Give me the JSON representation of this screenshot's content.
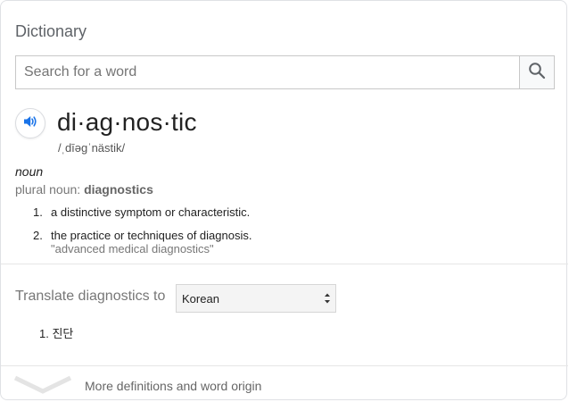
{
  "dictionary": {
    "title": "Dictionary",
    "search": {
      "placeholder": "Search for a word",
      "value": ""
    },
    "icons": {
      "search": "search-icon",
      "audio": "speaker-icon",
      "expand": "chevron-down-icon"
    },
    "entry": {
      "headword": "di·ag·nos·tic",
      "phonetic": "/ˌdīəɡˈnästik/",
      "part_of_speech": "noun",
      "plural_label": "plural noun:",
      "plural_form": "diagnostics",
      "definitions": [
        {
          "number": "1.",
          "text": "a distinctive symptom or characteristic.",
          "example": ""
        },
        {
          "number": "2.",
          "text": "the practice or techniques of diagnosis.",
          "example": "\"advanced medical diagnostics\""
        }
      ]
    },
    "translate": {
      "label": "Translate diagnostics to",
      "selected_language": "Korean",
      "results": [
        {
          "number": "1.",
          "text": "진단"
        }
      ]
    },
    "more_label": "More definitions and word origin",
    "accent_color": "#1a73e8"
  }
}
